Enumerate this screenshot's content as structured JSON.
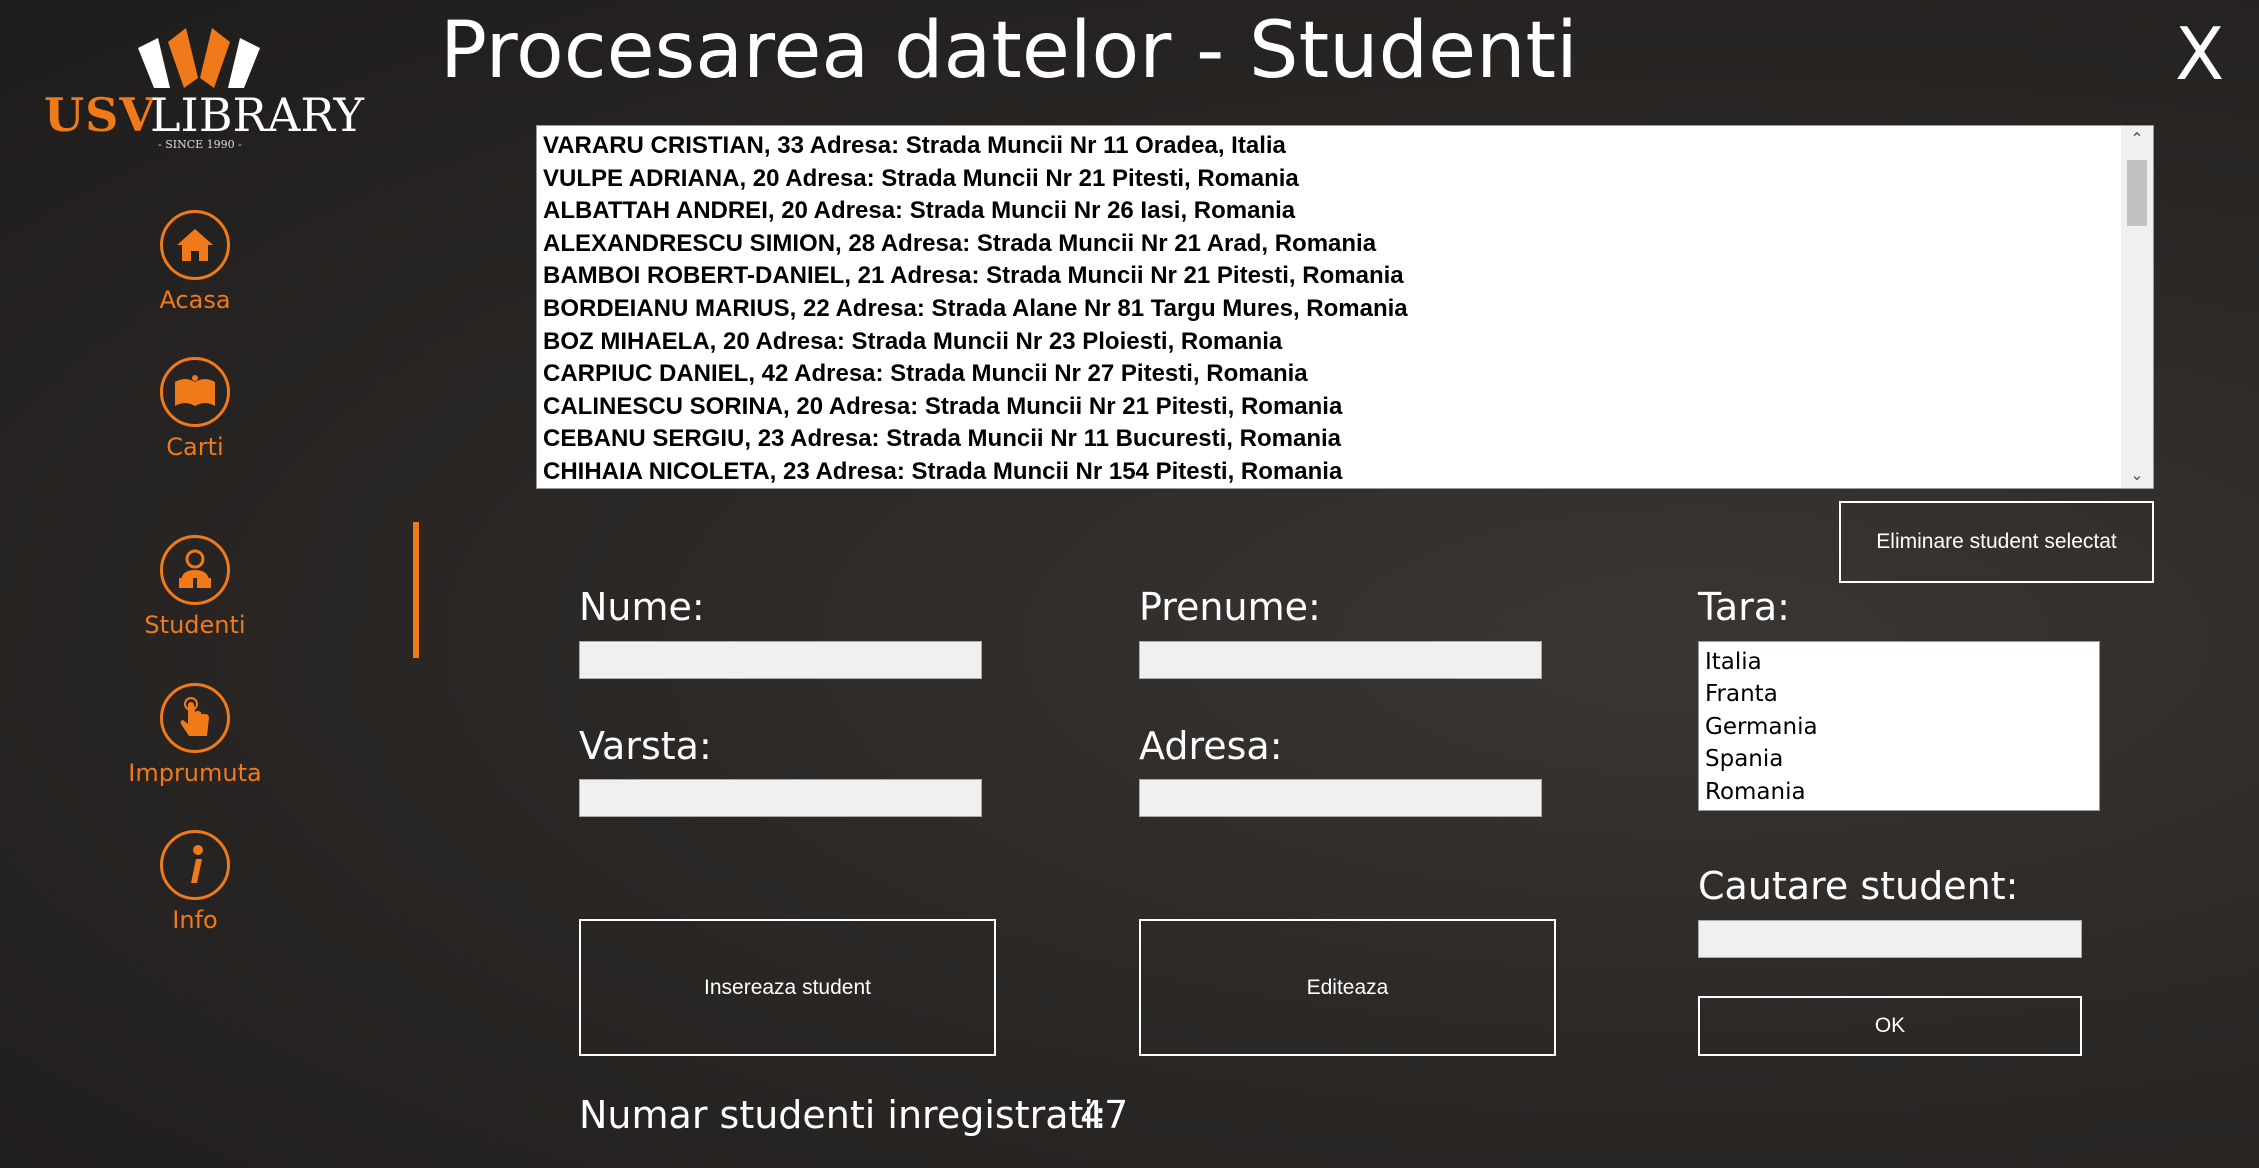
{
  "app": {
    "title": "Procesarea datelor - Studenti",
    "close_label": "X",
    "accent_color": "#f07a1a"
  },
  "logo": {
    "brand_left": "USV",
    "brand_right": "LIBRARY",
    "since": "- SINCE 1990 -"
  },
  "sidebar": {
    "items": [
      {
        "label": "Acasa",
        "icon": "home-icon"
      },
      {
        "label": "Carti",
        "icon": "book-icon"
      },
      {
        "label": "Studenti",
        "icon": "student-icon",
        "active": true
      },
      {
        "label": "Imprumuta",
        "icon": "hand-click-icon"
      },
      {
        "label": "Info",
        "icon": "info-icon"
      }
    ]
  },
  "students_list": {
    "rows": [
      "VARARU CRISTIAN, 33  Adresa: Strada Muncii Nr 11 Oradea, Italia",
      "VULPE ADRIANA, 20  Adresa: Strada Muncii Nr 21 Pitesti, Romania",
      "ALBATTAH ANDREI, 20  Adresa: Strada Muncii Nr 26 Iasi, Romania",
      "ALEXANDRESCU SIMION, 28  Adresa: Strada Muncii Nr 21 Arad, Romania",
      "BAMBOI ROBERT-DANIEL, 21  Adresa: Strada Muncii Nr 21 Pitesti, Romania",
      "BORDEIANU MARIUS, 22  Adresa: Strada Alane Nr 81 Targu Mures, Romania",
      "BOZ MIHAELA, 20  Adresa: Strada Muncii Nr 23 Ploiesti, Romania",
      "CARPIUC DANIEL, 42  Adresa: Strada Muncii Nr 27 Pitesti, Romania",
      "CALINESCU SORINA, 20  Adresa: Strada Muncii Nr 21 Pitesti, Romania",
      "CEBANU SERGIU, 23  Adresa: Strada Muncii Nr 11 Bucuresti, Romania",
      "CHIHAIA NICOLETA, 23  Adresa: Strada Muncii Nr 154 Pitesti, Romania"
    ]
  },
  "form": {
    "delete_button": "Eliminare student selectat",
    "nume_label": "Nume:",
    "prenume_label": "Prenume:",
    "tara_label": "Tara:",
    "varsta_label": "Varsta:",
    "adresa_label": "Adresa:",
    "nume_value": "",
    "prenume_value": "",
    "varsta_value": "",
    "adresa_value": "",
    "tara_options": [
      "Italia",
      "Franta",
      "Germania",
      "Spania",
      "Romania"
    ],
    "search_label": "Cautare student:",
    "search_value": "",
    "insert_button": "Insereaza student",
    "edit_button": "Editeaza",
    "ok_button": "OK"
  },
  "footer": {
    "count_label": "Numar studenti inregistrati:",
    "count_value": "47"
  }
}
